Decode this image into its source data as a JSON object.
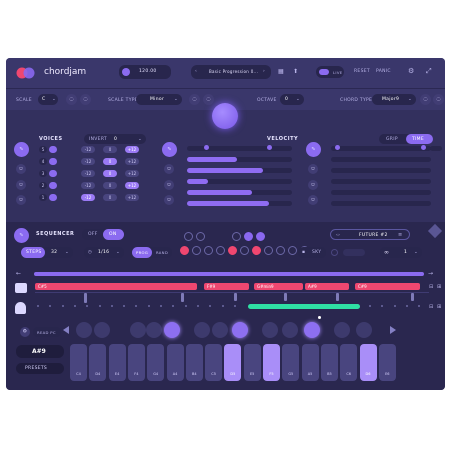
{
  "header": {
    "app_name": "chordjam",
    "tempo": "120.00",
    "preset_name": "Basic Progression 0...",
    "mode_label": "LIVE",
    "reset_label": "RESET",
    "panic_label": "PANIC"
  },
  "key_row": {
    "scale_label": "SCALE",
    "scale_value": "C",
    "scale_type_label": "SCALE TYPE",
    "scale_type_value": "Minor",
    "octave_label": "OCTAVE",
    "octave_value": "0",
    "chord_type_label": "CHORD TYPE",
    "chord_type_value": "Major9"
  },
  "voices": {
    "title": "VOICES",
    "invert_label": "INVERT",
    "invert_value": "0",
    "rows": [
      {
        "num": "5",
        "a": "-12",
        "b": "0",
        "c": "+12",
        "active": "c"
      },
      {
        "num": "4",
        "a": "-12",
        "b": "0",
        "c": "+12",
        "active": "b"
      },
      {
        "num": "3",
        "a": "-12",
        "b": "0",
        "c": "+12",
        "active": "b"
      },
      {
        "num": "2",
        "a": "-12",
        "b": "0",
        "c": "+12",
        "active": "c"
      },
      {
        "num": "1",
        "a": "-12",
        "b": "0",
        "c": "+12",
        "active": "a"
      }
    ]
  },
  "velocity": {
    "title": "VELOCITY",
    "levels": [
      0.6,
      0.48,
      0.72,
      0.2,
      0.62,
      0.78
    ]
  },
  "timing": {
    "grip_label": "GRIP",
    "time_label": "TIME",
    "levels": [
      0.15,
      0.0,
      0.0,
      0.0,
      0.0,
      0.0
    ]
  },
  "sequencer": {
    "title": "SEQUENCER",
    "off_label": "OFF",
    "on_label": "ON",
    "pattern_name": "FUTURE #2",
    "steps_label": "STEPS",
    "steps_value": "32",
    "rate_value": "1/16",
    "prog_label": "PROG",
    "rand_label": "RAND",
    "sky_label": "SKY",
    "repeat_value": "1",
    "chords": [
      "C#5",
      "F#9",
      "G#min9",
      "A#9",
      "C#9"
    ],
    "read_label": "READ PC",
    "root_display": "A#9",
    "presets_label": "PRESETS"
  },
  "keyboard": {
    "keys": [
      "C4",
      "D4",
      "E4",
      "F4",
      "G4",
      "A4",
      "B4",
      "C5",
      "D5",
      "E5",
      "F5",
      "G5",
      "A5",
      "B5",
      "C6",
      "D6",
      "E6"
    ],
    "active": [
      false,
      false,
      false,
      false,
      false,
      false,
      false,
      false,
      true,
      false,
      true,
      false,
      false,
      false,
      false,
      true,
      false
    ]
  },
  "colors": {
    "accent": "#8b6bf0",
    "pink": "#ef4770",
    "green": "#2fe0a4"
  }
}
